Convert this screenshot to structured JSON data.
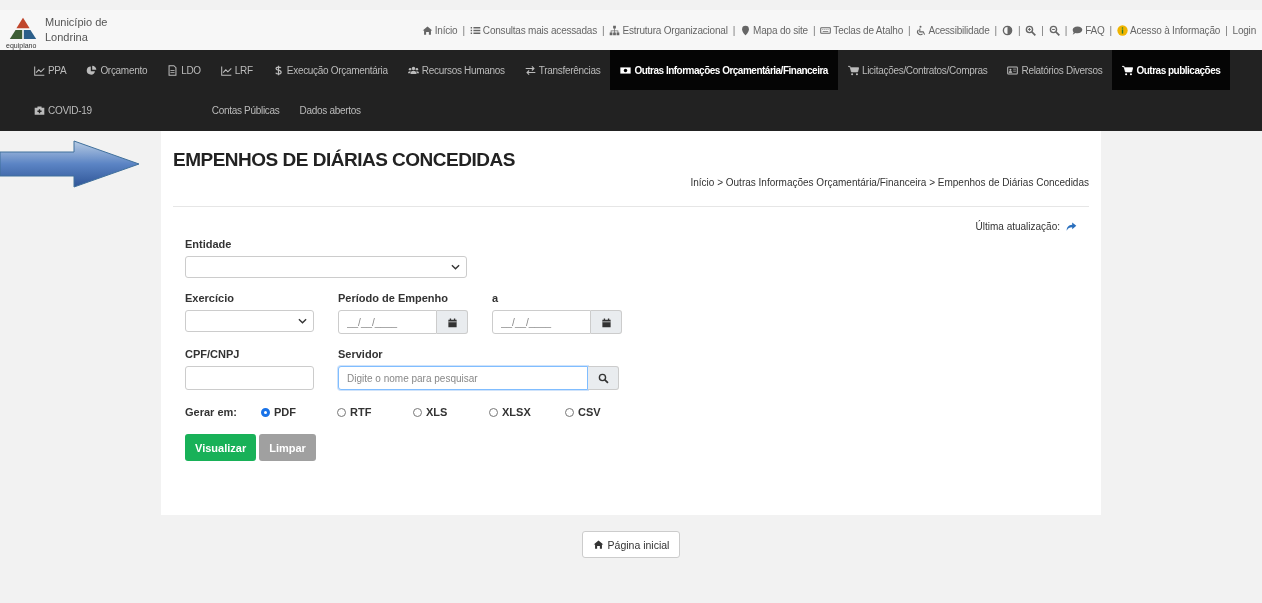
{
  "header": {
    "org_line1": "Município de",
    "org_line2": "Londrina",
    "logo_text": "equiplano",
    "links": [
      {
        "kind": "home",
        "label": "Início",
        "separator": "|"
      },
      {
        "kind": "list",
        "label": "Consultas mais acessadas",
        "separator": "|"
      },
      {
        "kind": "sitemap",
        "label": "Estrutura Organizacional",
        "separator": "|"
      },
      {
        "kind": "pin",
        "label": "Mapa do site",
        "separator": "|"
      },
      {
        "kind": "keyboard",
        "label": "Teclas de Atalho",
        "separator": "|"
      },
      {
        "kind": "wheelchair",
        "label": "Acessibilidade",
        "separator": "|"
      },
      {
        "kind": "contrast",
        "separator": "|"
      },
      {
        "kind": "zoomin",
        "separator": "|"
      },
      {
        "kind": "zoomout",
        "separator": "|"
      },
      {
        "kind": "chat",
        "label": "FAQ",
        "separator": "|"
      },
      {
        "kind": "info",
        "label": "Acesso à Informação",
        "separator": "|"
      },
      {
        "kind": "text",
        "label": "Login"
      }
    ]
  },
  "nav": {
    "items": [
      {
        "kind": "chart",
        "label": "PPA",
        "selected": false
      },
      {
        "kind": "pie",
        "label": "Orçamento",
        "selected": false
      },
      {
        "kind": "doc",
        "label": "LDO",
        "selected": false
      },
      {
        "kind": "chart",
        "label": "LRF",
        "selected": false
      },
      {
        "kind": "dollar",
        "label": "Execução Orçamentária",
        "selected": false
      },
      {
        "kind": "users",
        "label": "Recursos Humanos",
        "selected": false
      },
      {
        "kind": "exchange",
        "label": "Transferências",
        "selected": false
      },
      {
        "kind": "money",
        "label": "Outras Informações Orçamentária/Financeira",
        "selected": true
      },
      {
        "kind": "cart",
        "label": "Licitações/Contratos/Compras",
        "selected": false
      },
      {
        "kind": "card",
        "label": "Relatórios Diversos",
        "selected": false
      },
      {
        "kind": "cart",
        "label": "Outras publicações",
        "selected": true
      },
      {
        "kind": "medkit",
        "label": "COVID-19",
        "selected": false
      },
      {
        "kind": "text",
        "label": "Contas Públicas",
        "selected": false
      },
      {
        "kind": "text",
        "label": "Dados abertos",
        "selected": false
      }
    ]
  },
  "page": {
    "title": "EMPENHOS DE DIÁRIAS CONCEDIDAS",
    "breadcrumb": "Início > Outras Informações Orçamentária/Financeira > Empenhos de Diárias Concedidas",
    "last_update": "Última atualização:"
  },
  "form": {
    "entidade_label": "Entidade",
    "exercicio_label": "Exercício",
    "periodo_label": "Período de Empenho",
    "periodo_from_placeholder": "__/__/____",
    "a_label": "a",
    "periodo_to_placeholder": "__/__/____",
    "cpf_label": "CPF/CNPJ",
    "servidor_label": "Servidor",
    "servidor_placeholder": "Digite o nome para pesquisar",
    "gerar_label": "Gerar em:",
    "formats": [
      {
        "label": "PDF",
        "selected": true
      },
      {
        "label": "RTF",
        "selected": false
      },
      {
        "label": "XLS",
        "selected": false
      },
      {
        "label": "XLSX",
        "selected": false
      },
      {
        "label": "CSV",
        "selected": false
      }
    ],
    "buttons": {
      "primary": "Visualizar",
      "secondary": "Limpar"
    }
  },
  "home_button": "Página inicial"
}
